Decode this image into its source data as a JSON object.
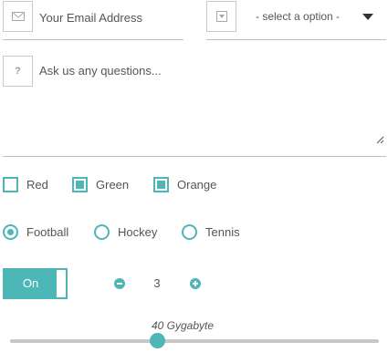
{
  "email": {
    "placeholder": "Your Email Address",
    "icon": "envelope-icon"
  },
  "select": {
    "value": "- select a option -",
    "icon": "dropdown-icon"
  },
  "question": {
    "placeholder": "Ask us any questions...",
    "icon": "question-icon",
    "icon_glyph": "?"
  },
  "checkboxes": [
    {
      "label": "Red",
      "checked": false
    },
    {
      "label": "Green",
      "checked": true
    },
    {
      "label": "Orange",
      "checked": true
    }
  ],
  "radios": [
    {
      "label": "Football",
      "checked": true
    },
    {
      "label": "Hockey",
      "checked": false
    },
    {
      "label": "Tennis",
      "checked": false
    }
  ],
  "toggle": {
    "label": "On",
    "state": true
  },
  "stepper": {
    "value": "3"
  },
  "slider": {
    "caption": "40 Gygabyte",
    "fraction": 0.4
  },
  "colors": {
    "accent": "#4db6b6",
    "text": "#555555",
    "track": "#c8c8c8"
  }
}
